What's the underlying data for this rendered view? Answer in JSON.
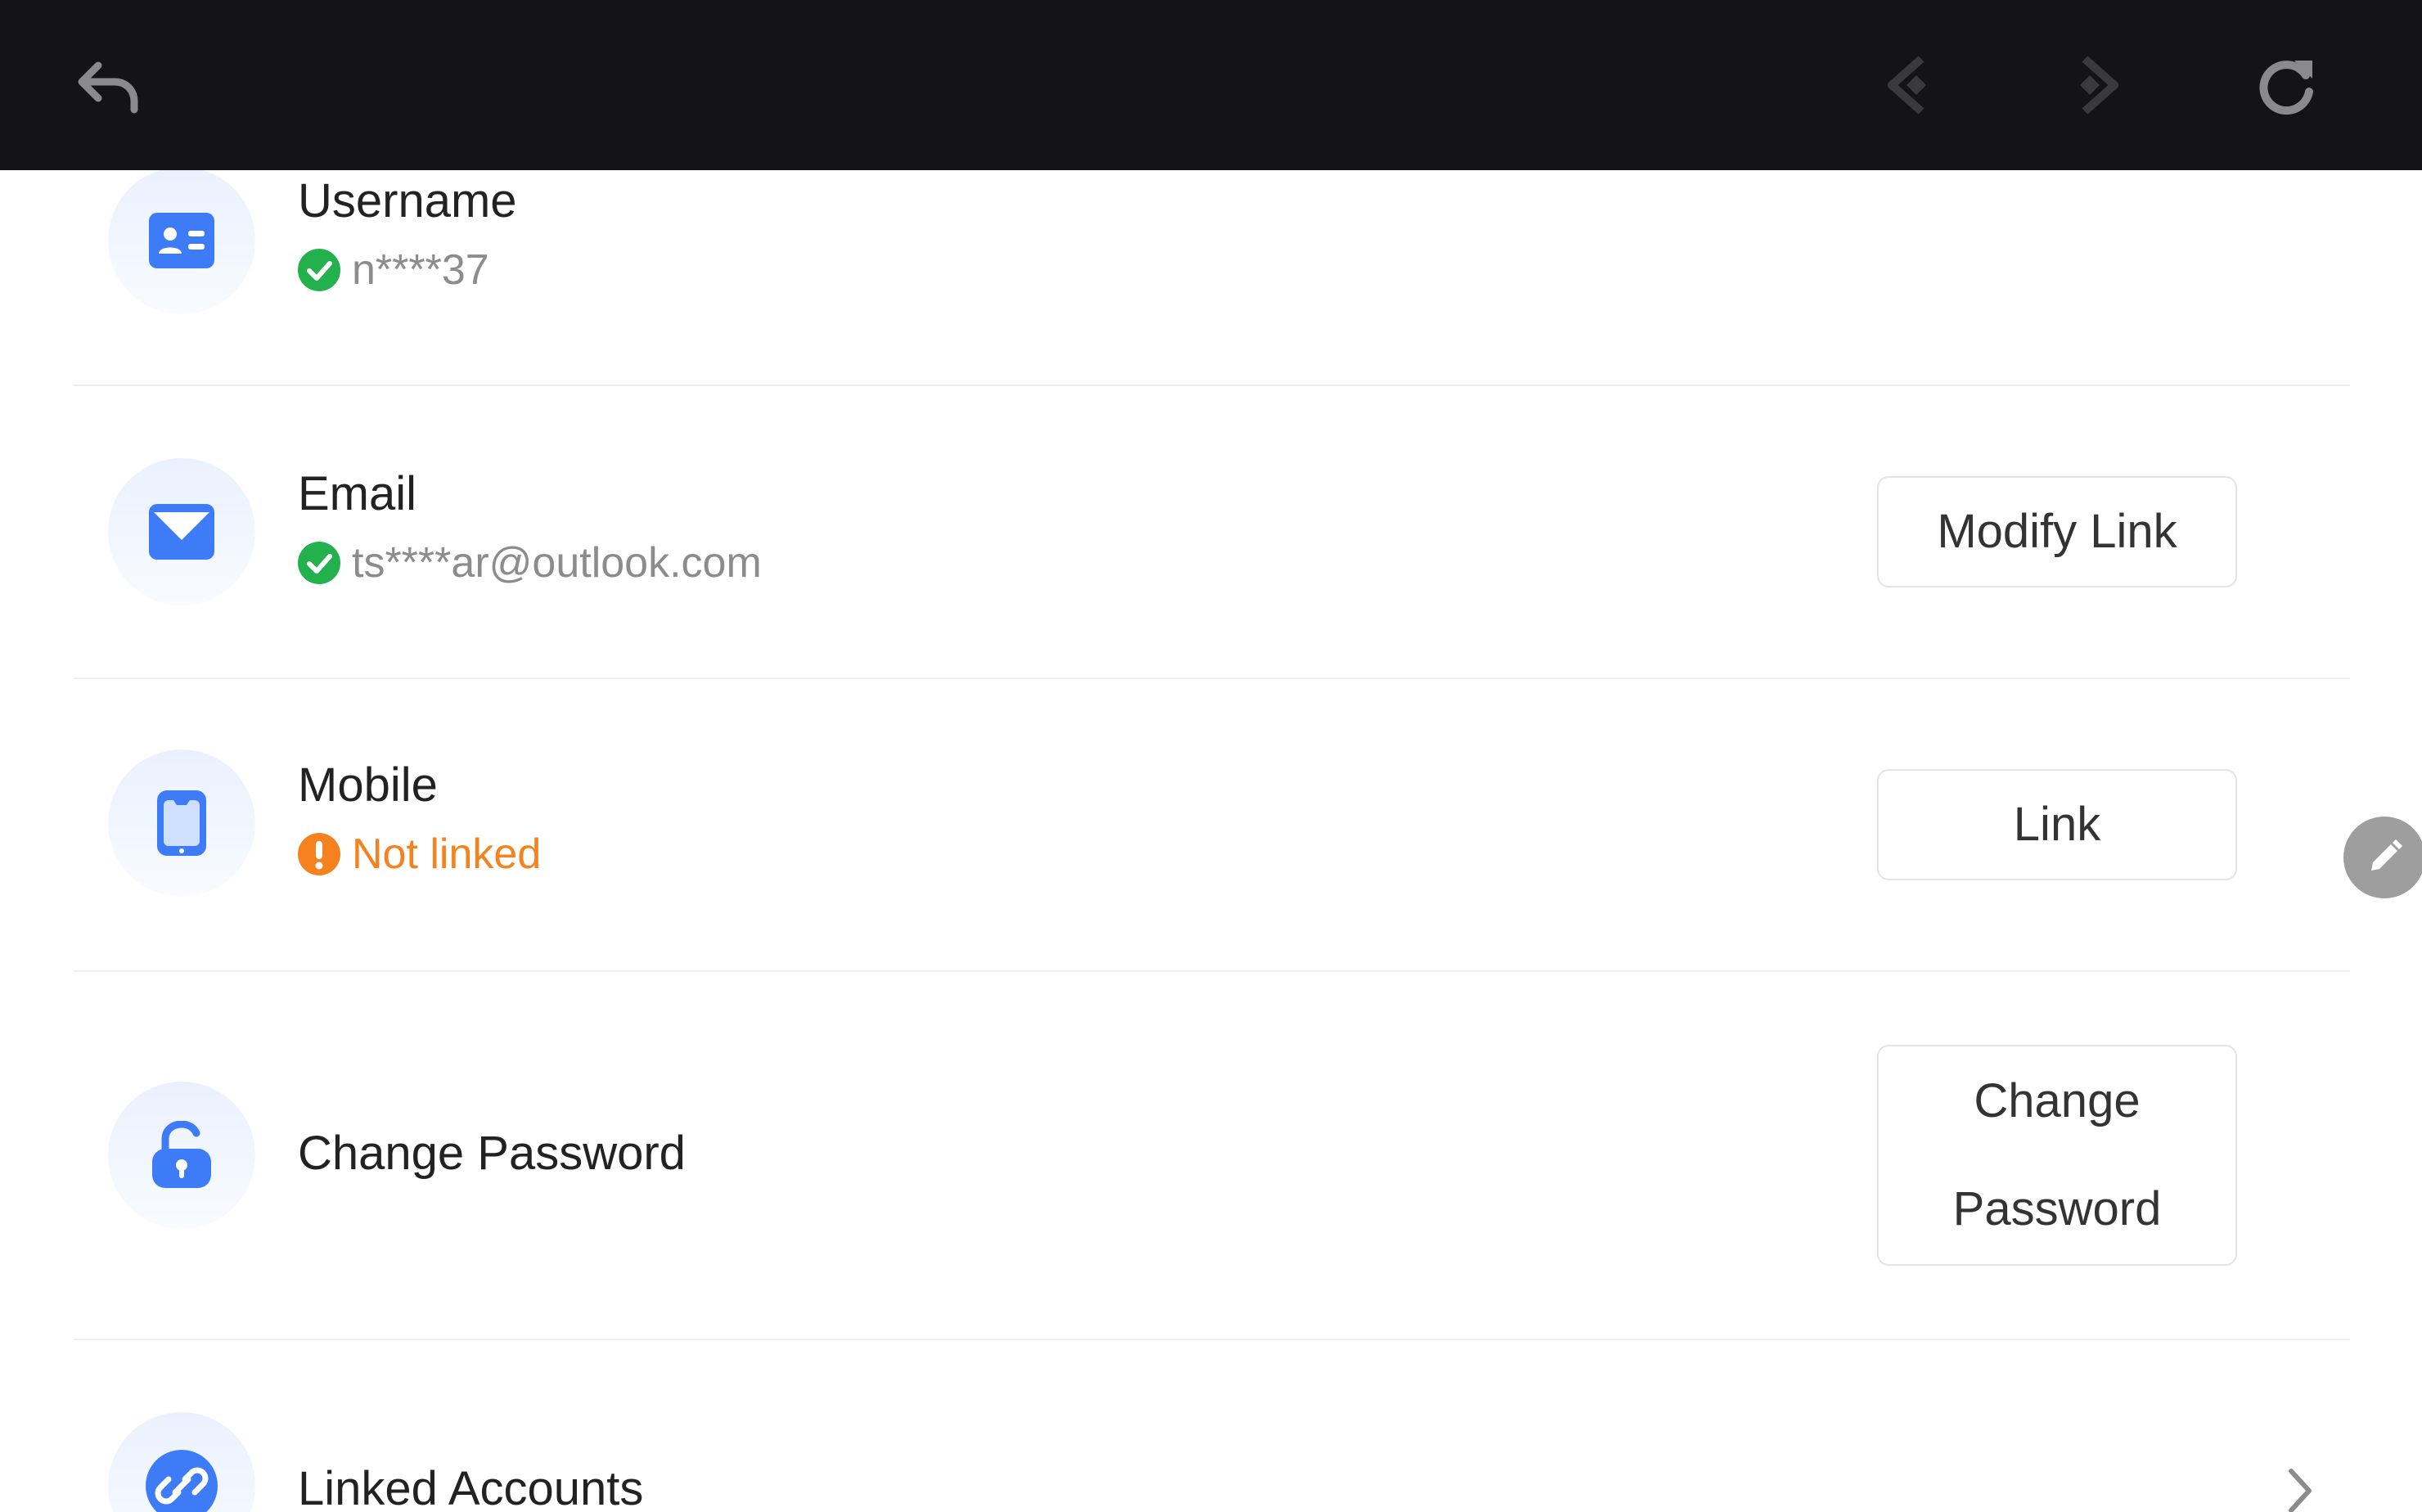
{
  "toolbar": {
    "back_icon": "undo-arrow-icon",
    "prev_icon": "navigate-back-icon",
    "next_icon": "navigate-forward-icon",
    "refresh_icon": "refresh-icon"
  },
  "rows": {
    "username": {
      "label": "Username",
      "value": "n****37",
      "status": "verified",
      "icon": "id-card-icon"
    },
    "email": {
      "label": "Email",
      "value": "ts****ar@outlook.com",
      "status": "verified",
      "icon": "envelope-icon",
      "button": "Modify Link"
    },
    "mobile": {
      "label": "Mobile",
      "value": "Not linked",
      "status": "warning",
      "icon": "phone-icon",
      "button": "Link"
    },
    "password": {
      "label": "Change Password",
      "icon": "lock-icon",
      "button": "Change Password"
    },
    "linked": {
      "label": "Linked Accounts",
      "icon": "link-icon"
    }
  },
  "colors": {
    "topbar": "#141416",
    "accent_blue": "#3d7bf7",
    "verified_green": "#22b14c",
    "warning_orange": "#f5821f"
  }
}
